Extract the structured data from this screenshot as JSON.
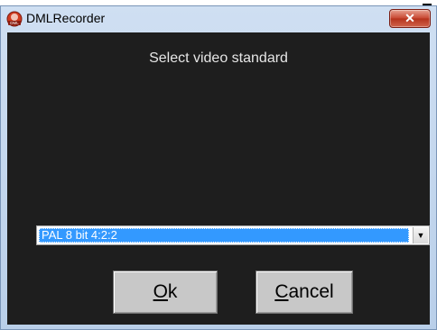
{
  "window": {
    "title": "DMLRecorder",
    "close_glyph": "✕",
    "icon": "dml-app-icon"
  },
  "dialog": {
    "prompt": "Select video standard",
    "video_standard": {
      "selected": "PAL 8 bit 4:2:2",
      "arrow_glyph": "▼"
    },
    "ok_button": {
      "mnemonic": "O",
      "rest": "k"
    },
    "cancel_button": {
      "mnemonic": "C",
      "rest": "ancel"
    }
  },
  "colors": {
    "client_bg": "#1e1e1e",
    "selection": "#3399ff",
    "close_button": "#c7452f",
    "titlebar": "#c4d7ee"
  }
}
